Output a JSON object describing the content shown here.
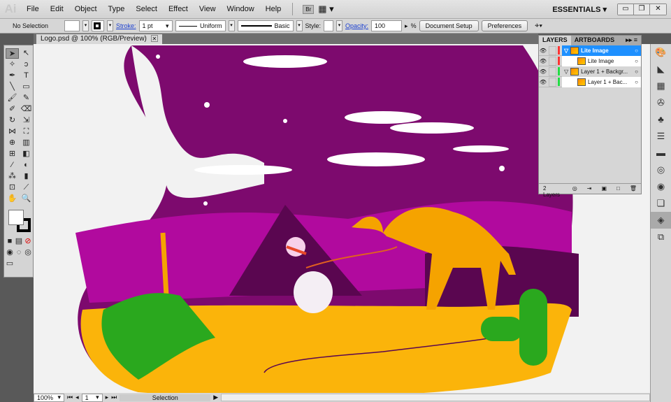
{
  "app": {
    "logo": "Ai",
    "menus": [
      "File",
      "Edit",
      "Object",
      "Type",
      "Select",
      "Effect",
      "View",
      "Window",
      "Help"
    ],
    "bridge": "Br",
    "workspace": "ESSENTIALS",
    "window_buttons": [
      "minimize",
      "restore",
      "close"
    ]
  },
  "control": {
    "selection": "No Selection",
    "stroke_label": "Stroke:",
    "stroke_weight": "1 pt",
    "profile": "Uniform",
    "brush": "Basic",
    "style_label": "Style:",
    "opacity_label": "Opacity:",
    "opacity": "100",
    "percent": "%",
    "doc_setup": "Document Setup",
    "preferences": "Preferences"
  },
  "document": {
    "tab": "Logo.psd @ 100% (RGB/Preview)"
  },
  "layers": {
    "tabs": [
      "LAYERS",
      "ARTBOARDS"
    ],
    "rows": [
      {
        "name": "Lite Image",
        "color": "#ff3333",
        "selected": true
      },
      {
        "name": "Lite Image",
        "color": "#ff3333",
        "selected": false
      },
      {
        "name": "Layer 1 + Backgr...",
        "color": "#22dd44",
        "selected": false
      },
      {
        "name": "Layer 1 + Bac...",
        "color": "#22dd44",
        "selected": false
      }
    ],
    "count": "2 Layers"
  },
  "status": {
    "zoom": "100%",
    "page": "1",
    "tool": "Selection"
  },
  "colors": {
    "sky": "#7d0a6e",
    "sand": "#fbb40a",
    "camel": "#f5a300",
    "cactus": "#2aa81e",
    "selection": "#1e90ff"
  }
}
